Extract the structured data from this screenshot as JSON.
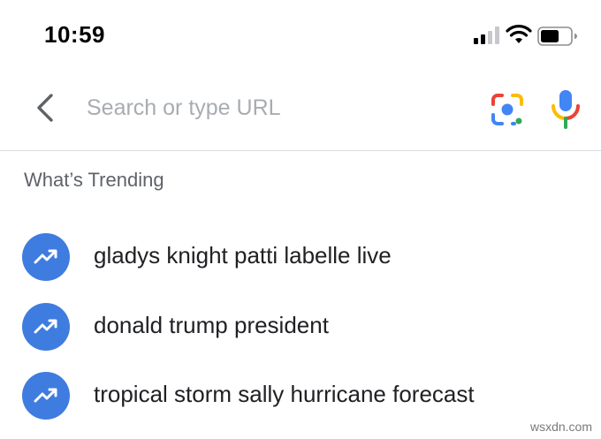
{
  "status_bar": {
    "time": "10:59"
  },
  "search": {
    "placeholder": "Search or type URL"
  },
  "trending": {
    "heading": "What’s Trending",
    "items": [
      {
        "label": "gladys knight patti labelle live"
      },
      {
        "label": "donald trump president"
      },
      {
        "label": "tropical storm sally hurricane forecast"
      }
    ]
  },
  "icons": {
    "back": "chevron-left-icon",
    "lens": "google-lens-icon",
    "mic": "microphone-icon",
    "trend": "trending-up-icon"
  },
  "colors": {
    "trend_badge": "#3f7ce0",
    "placeholder": "#a8acb1",
    "heading": "#5f6368",
    "google_blue": "#4285f4",
    "google_red": "#ea4335",
    "google_yellow": "#fbbc05",
    "google_green": "#34a853"
  },
  "watermark": "wsxdn.com"
}
